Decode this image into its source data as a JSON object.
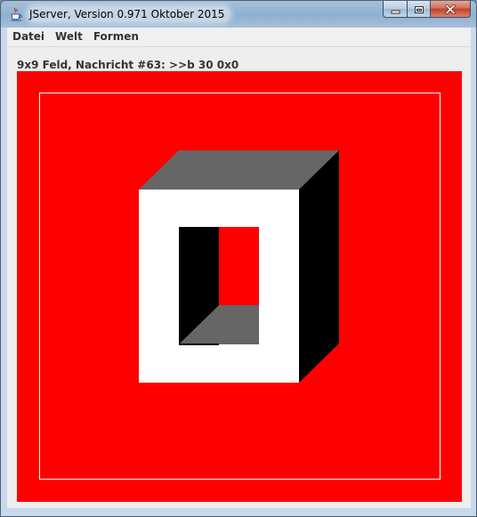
{
  "window": {
    "title": "JServer, Version 0.971 Oktober 2015",
    "app_icon": "java-cup-icon",
    "controls": {
      "minimize_icon": "minimize-icon",
      "maximize_icon": "maximize-icon",
      "close_icon": "close-icon"
    }
  },
  "menu": {
    "items": [
      {
        "label": "Datei"
      },
      {
        "label": "Welt"
      },
      {
        "label": "Formen"
      }
    ]
  },
  "status": {
    "text": "9x9 Feld, Nachricht #63: >>b 30 0x0"
  },
  "board": {
    "background_color": "#ff0000",
    "border_color": "#ffffff",
    "shape": "hollow-cube",
    "front_color": "#ffffff",
    "top_color": "#666666",
    "side_color": "#000000",
    "inner_back_color": "#ff0000"
  }
}
